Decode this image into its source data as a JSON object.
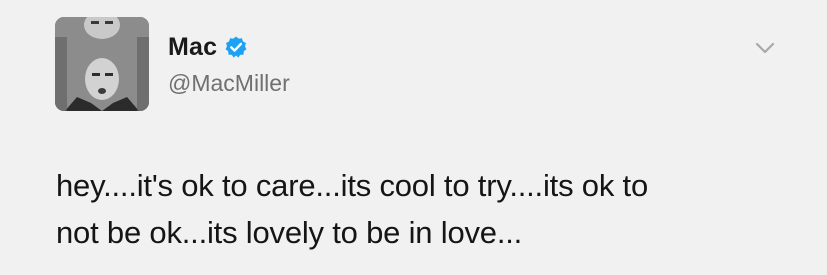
{
  "user": {
    "display_name": "Mac",
    "handle": "@MacMiller",
    "verified": true,
    "verified_color": "#1da1f2"
  },
  "tweet": {
    "text_lines": [
      "hey....it's ok to care...its cool to try....its ok to",
      "not be ok...its lovely to be in love..."
    ]
  },
  "icons": {
    "verified": "verified-badge-icon",
    "menu": "chevron-down-icon"
  }
}
